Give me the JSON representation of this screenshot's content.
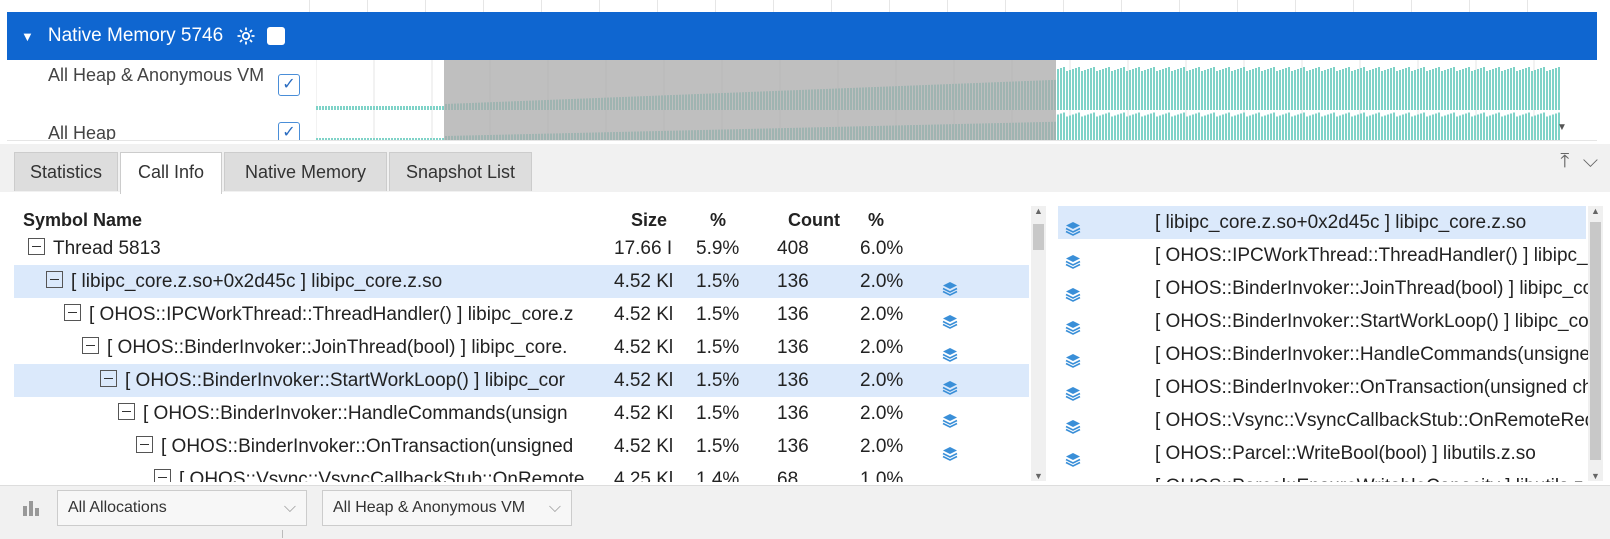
{
  "banner": {
    "title": "Native Memory 5746"
  },
  "tracks": [
    {
      "label": "All Heap & Anonymous VM",
      "checked": "✓"
    },
    {
      "label": "All Heap",
      "checked": "✓"
    }
  ],
  "tabs": [
    {
      "label": "Statistics"
    },
    {
      "label": "Call Info"
    },
    {
      "label": "Native Memory"
    },
    {
      "label": "Snapshot List"
    }
  ],
  "table": {
    "headers": {
      "symbol": "Symbol Name",
      "size": "Size",
      "pct1": "%",
      "count": "Count",
      "pct2": "%"
    },
    "rows": [
      {
        "name": "Thread 5813",
        "size": "17.66 I",
        "pct1": "5.9%",
        "count": "408",
        "pct2": "6.0%"
      },
      {
        "name": "[ libipc_core.z.so+0x2d45c ] libipc_core.z.so",
        "size": "4.52 Kl",
        "pct1": "1.5%",
        "count": "136",
        "pct2": "2.0%"
      },
      {
        "name": "[ OHOS::IPCWorkThread::ThreadHandler() ] libipc_core.z",
        "size": "4.52 Kl",
        "pct1": "1.5%",
        "count": "136",
        "pct2": "2.0%"
      },
      {
        "name": "[ OHOS::BinderInvoker::JoinThread(bool) ] libipc_core.",
        "size": "4.52 Kl",
        "pct1": "1.5%",
        "count": "136",
        "pct2": "2.0%"
      },
      {
        "name": "[ OHOS::BinderInvoker::StartWorkLoop() ] libipc_cor",
        "size": "4.52 Kl",
        "pct1": "1.5%",
        "count": "136",
        "pct2": "2.0%"
      },
      {
        "name": "[ OHOS::BinderInvoker::HandleCommands(unsign",
        "size": "4.52 Kl",
        "pct1": "1.5%",
        "count": "136",
        "pct2": "2.0%"
      },
      {
        "name": "[ OHOS::BinderInvoker::OnTransaction(unsigned",
        "size": "4.52 Kl",
        "pct1": "1.5%",
        "count": "136",
        "pct2": "2.0%"
      },
      {
        "name": "[ OHOS::Vsync::VsyncCallbackStub::OnRemote",
        "size": "4.25 Kl",
        "pct1": "1.4%",
        "count": "68",
        "pct2": "1.0%"
      }
    ]
  },
  "stack": [
    "[ libipc_core.z.so+0x2d45c ] libipc_core.z.so",
    "[ OHOS::IPCWorkThread::ThreadHandler() ] libipc_core.z.so",
    "[ OHOS::BinderInvoker::JoinThread(bool) ] libipc_core.z.so",
    "[ OHOS::BinderInvoker::StartWorkLoop() ] libipc_core.z.so",
    "[ OHOS::BinderInvoker::HandleCommands(unsigned int) ] libipc_core.z.so",
    "[ OHOS::BinderInvoker::OnTransaction(unsigned char const*) ] libipc_core.z.so",
    "[ OHOS::Vsync::VsyncCallbackStub::OnRemoteRequest ] libvsync.z.so",
    "[ OHOS::Parcel::WriteBool(bool) ] libutils.z.so",
    "[ OHOS::Parcel::EnsureWritableCapacity ] libutils.z.so"
  ],
  "footer": {
    "alloc_filter": "All Allocations",
    "vm_filter": "All Heap & Anonymous VM"
  },
  "colors": {
    "banner": "#0f66d0",
    "selection": "#dbe9fb",
    "memory_bar": "#7fd3c8",
    "range_shade": "#a9a9a9"
  }
}
